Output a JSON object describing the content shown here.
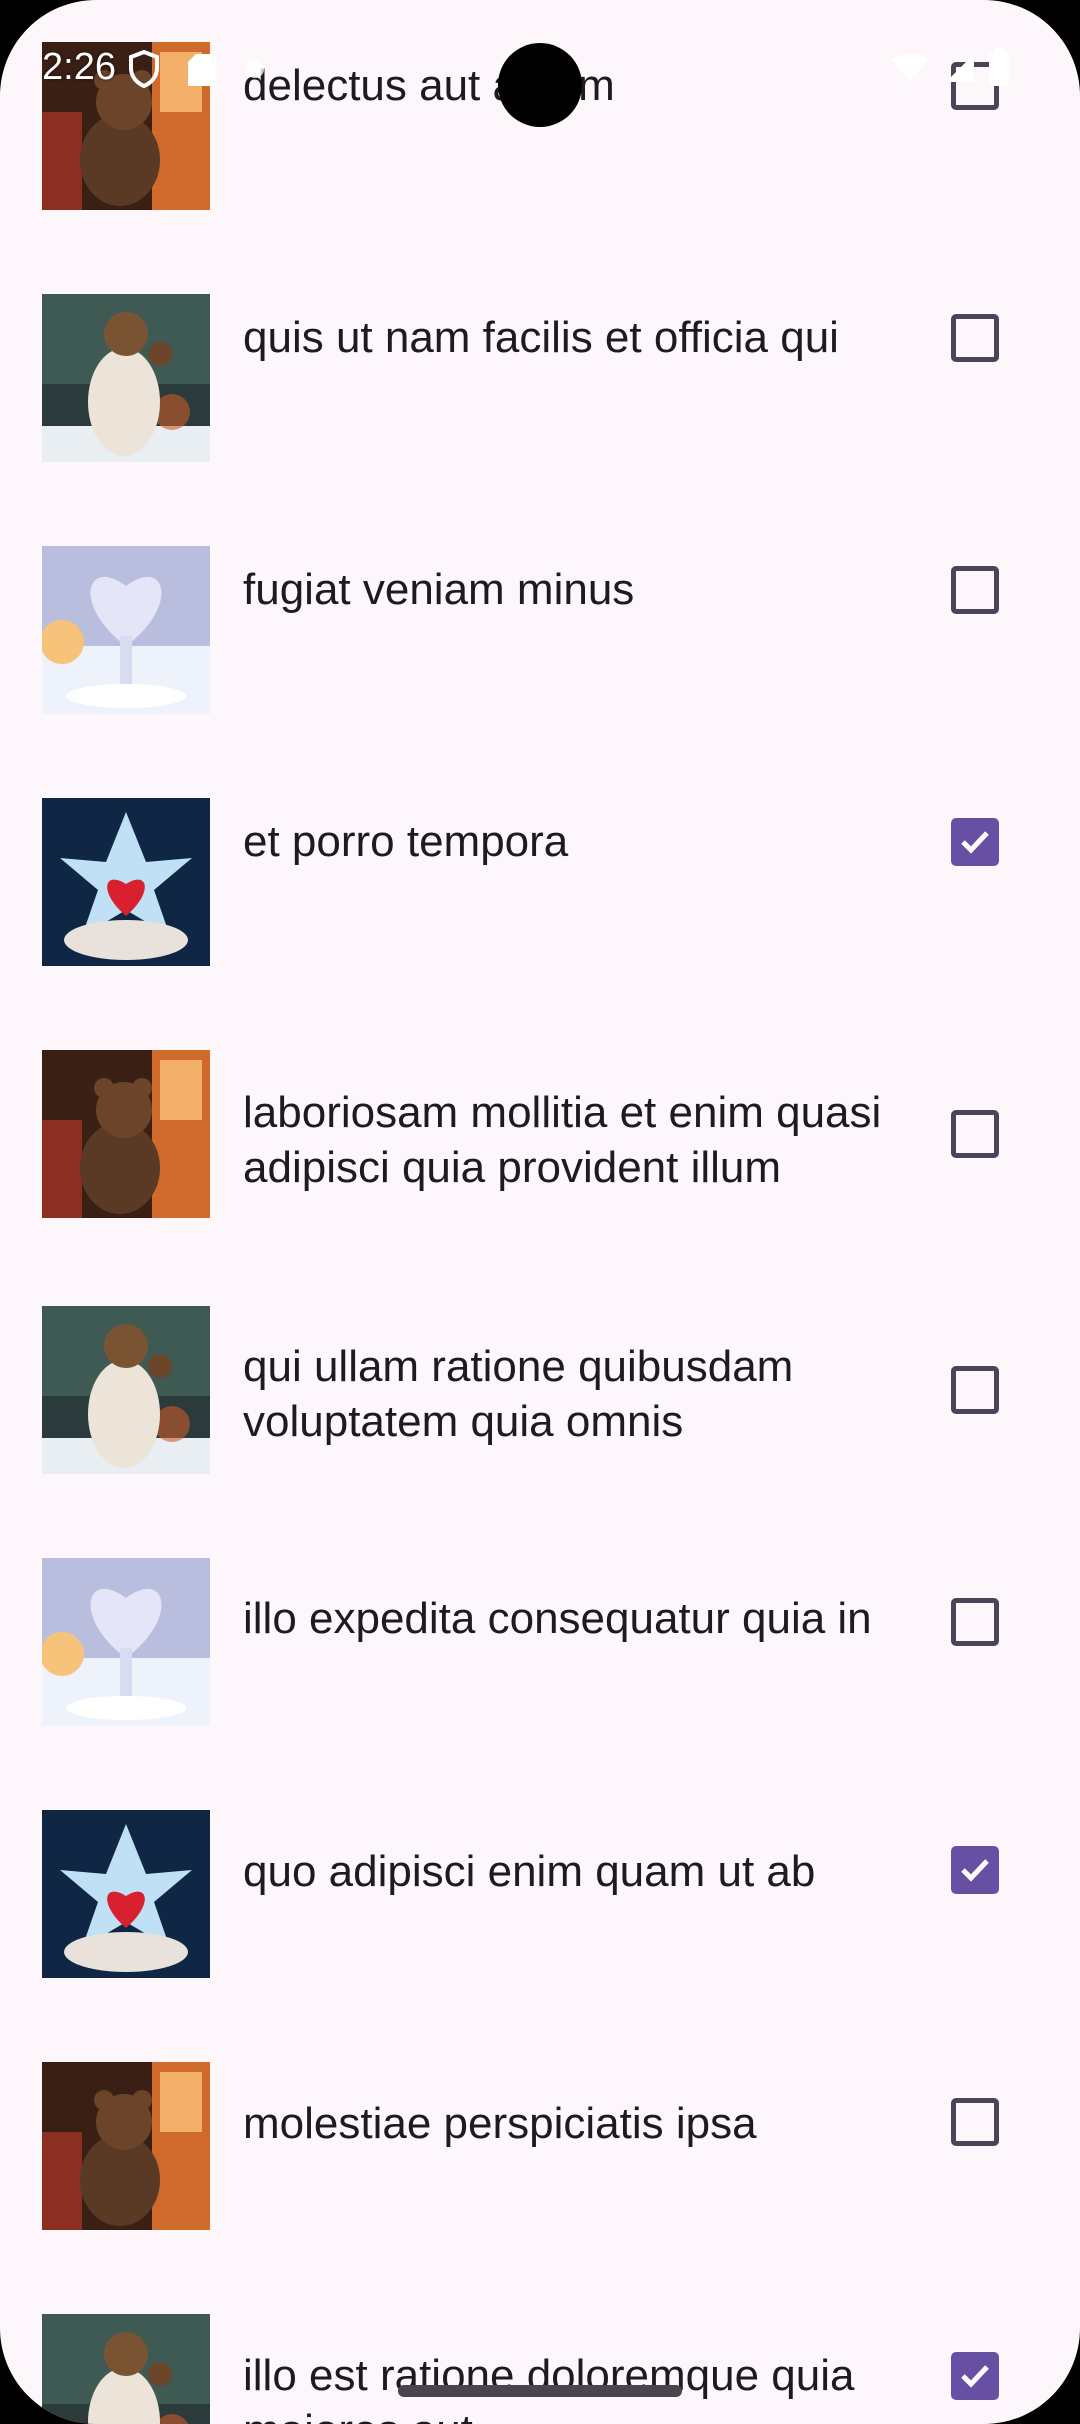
{
  "status_bar": {
    "time": "2:26"
  },
  "items": [
    {
      "title": "delectus aut autem",
      "checked": false,
      "image": "bear-window"
    },
    {
      "title": "quis ut nam facilis et officia qui",
      "checked": false,
      "image": "bear-coat"
    },
    {
      "title": "fugiat veniam minus",
      "checked": false,
      "image": "crystal-heart-tree"
    },
    {
      "title": "et porro tempora",
      "checked": true,
      "image": "ice-heart-hands"
    },
    {
      "title": "laboriosam mollitia et enim quasi adipisci quia provident illum",
      "checked": false,
      "image": "bear-window"
    },
    {
      "title": "qui ullam ratione quibusdam voluptatem quia omnis",
      "checked": false,
      "image": "bear-coat"
    },
    {
      "title": "illo expedita consequatur quia in",
      "checked": false,
      "image": "crystal-heart-tree"
    },
    {
      "title": "quo adipisci enim quam ut ab",
      "checked": true,
      "image": "ice-heart-hands"
    },
    {
      "title": "molestiae perspiciatis ipsa",
      "checked": false,
      "image": "bear-window"
    },
    {
      "title": "illo est ratione doloremque quia maiores aut",
      "checked": true,
      "image": "bear-coat"
    }
  ],
  "colors": {
    "background": "#FDF7FC",
    "checkbox_checked": "#6750A4",
    "checkbox_border": "#4A4458",
    "text": "#1D1B20"
  }
}
